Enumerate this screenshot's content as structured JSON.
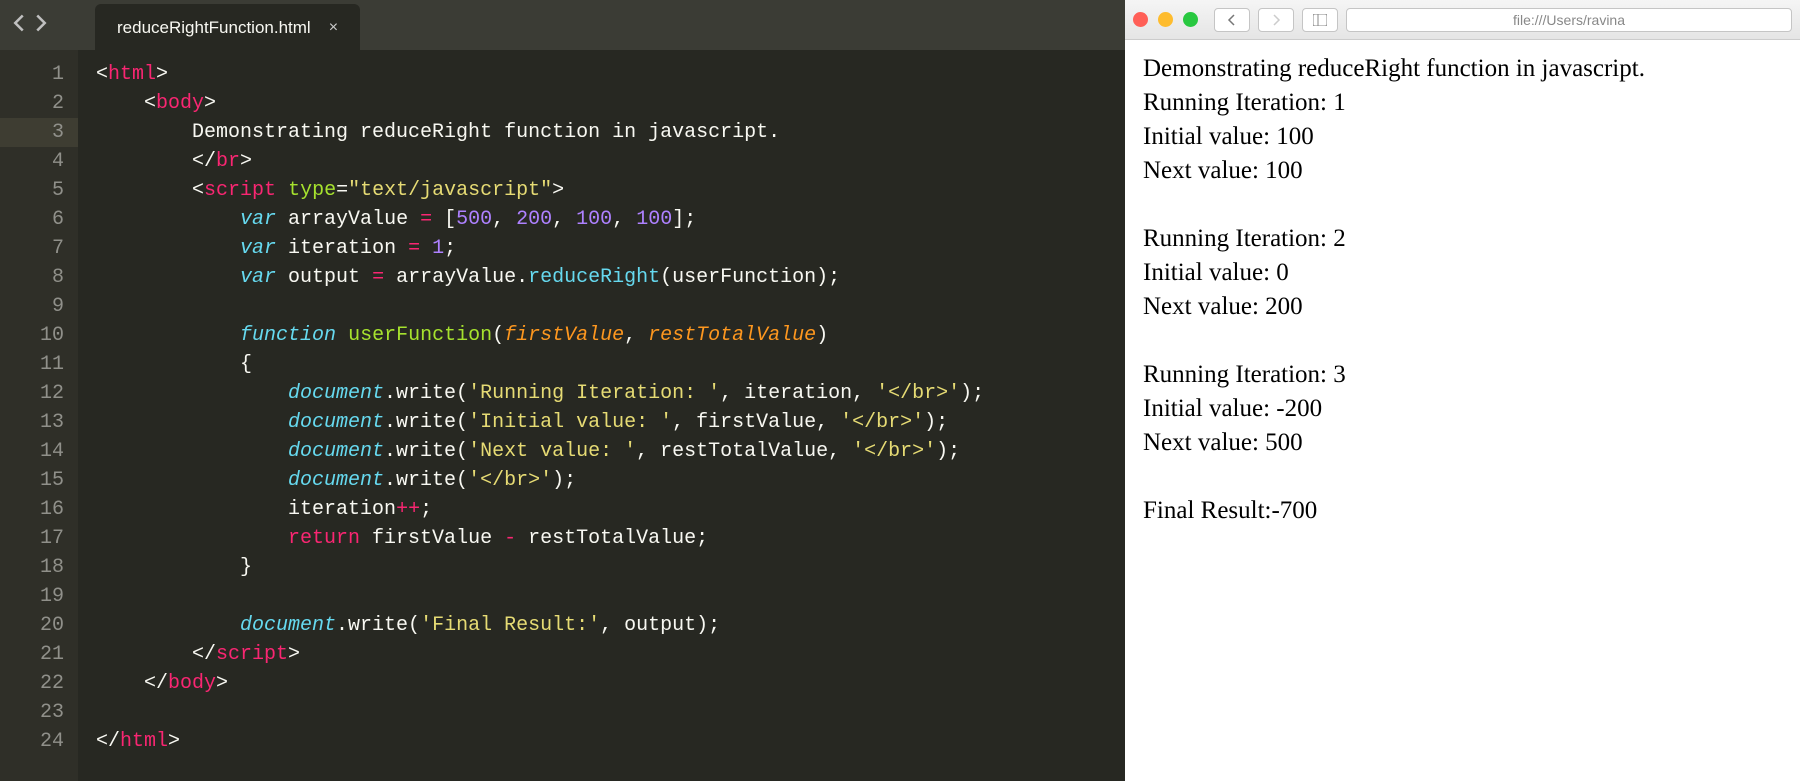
{
  "editor": {
    "tab_name": "reduceRightFunction.html",
    "line_count": 24,
    "highlighted_line": 3,
    "code_tokens": [
      [
        [
          "<",
          "c-white"
        ],
        [
          "html",
          "c-pink"
        ],
        [
          ">",
          "c-white"
        ]
      ],
      [
        [
          "    <",
          "c-white"
        ],
        [
          "body",
          "c-pink"
        ],
        [
          ">",
          "c-white"
        ]
      ],
      [
        [
          "        Demonstrating reduceRight function in javascript.",
          "c-white"
        ]
      ],
      [
        [
          "        </",
          "c-white"
        ],
        [
          "br",
          "c-pink"
        ],
        [
          ">",
          "c-white"
        ]
      ],
      [
        [
          "        <",
          "c-white"
        ],
        [
          "script",
          "c-pink"
        ],
        [
          " ",
          "c-white"
        ],
        [
          "type",
          "c-green"
        ],
        [
          "=",
          "c-white"
        ],
        [
          "\"text/javascript\"",
          "c-yellow"
        ],
        [
          ">",
          "c-white"
        ]
      ],
      [
        [
          "            ",
          "c-white"
        ],
        [
          "var",
          "c-cyan-i"
        ],
        [
          " arrayValue ",
          "c-white"
        ],
        [
          "=",
          "c-pink"
        ],
        [
          " [",
          "c-white"
        ],
        [
          "500",
          "c-purple"
        ],
        [
          ", ",
          "c-white"
        ],
        [
          "200",
          "c-purple"
        ],
        [
          ", ",
          "c-white"
        ],
        [
          "100",
          "c-purple"
        ],
        [
          ", ",
          "c-white"
        ],
        [
          "100",
          "c-purple"
        ],
        [
          "];",
          "c-white"
        ]
      ],
      [
        [
          "            ",
          "c-white"
        ],
        [
          "var",
          "c-cyan-i"
        ],
        [
          " iteration ",
          "c-white"
        ],
        [
          "=",
          "c-pink"
        ],
        [
          " ",
          "c-white"
        ],
        [
          "1",
          "c-purple"
        ],
        [
          ";",
          "c-white"
        ]
      ],
      [
        [
          "            ",
          "c-white"
        ],
        [
          "var",
          "c-cyan-i"
        ],
        [
          " output ",
          "c-white"
        ],
        [
          "=",
          "c-pink"
        ],
        [
          " arrayValue.",
          "c-white"
        ],
        [
          "reduceRight",
          "c-cyan"
        ],
        [
          "(userFunction);",
          "c-white"
        ]
      ],
      [
        [
          "",
          "c-white"
        ]
      ],
      [
        [
          "            ",
          "c-white"
        ],
        [
          "function",
          "c-cyan-i"
        ],
        [
          " ",
          "c-white"
        ],
        [
          "userFunction",
          "c-green"
        ],
        [
          "(",
          "c-white"
        ],
        [
          "firstValue",
          "c-orange"
        ],
        [
          ", ",
          "c-white"
        ],
        [
          "restTotalValue",
          "c-orange"
        ],
        [
          ")",
          "c-white"
        ]
      ],
      [
        [
          "            {",
          "c-white"
        ]
      ],
      [
        [
          "                ",
          "c-white"
        ],
        [
          "document",
          "c-cyan italic"
        ],
        [
          ".write(",
          "c-white"
        ],
        [
          "'Running Iteration: '",
          "c-yellow"
        ],
        [
          ", iteration, ",
          "c-white"
        ],
        [
          "'</br>'",
          "c-yellow"
        ],
        [
          ");",
          "c-white"
        ]
      ],
      [
        [
          "                ",
          "c-white"
        ],
        [
          "document",
          "c-cyan italic"
        ],
        [
          ".write(",
          "c-white"
        ],
        [
          "'Initial value: '",
          "c-yellow"
        ],
        [
          ", firstValue, ",
          "c-white"
        ],
        [
          "'</br>'",
          "c-yellow"
        ],
        [
          ");",
          "c-white"
        ]
      ],
      [
        [
          "                ",
          "c-white"
        ],
        [
          "document",
          "c-cyan italic"
        ],
        [
          ".write(",
          "c-white"
        ],
        [
          "'Next value: '",
          "c-yellow"
        ],
        [
          ", restTotalValue, ",
          "c-white"
        ],
        [
          "'</br>'",
          "c-yellow"
        ],
        [
          ");",
          "c-white"
        ]
      ],
      [
        [
          "                ",
          "c-white"
        ],
        [
          "document",
          "c-cyan italic"
        ],
        [
          ".write(",
          "c-white"
        ],
        [
          "'</br>'",
          "c-yellow"
        ],
        [
          ");",
          "c-white"
        ]
      ],
      [
        [
          "                iteration",
          "c-white"
        ],
        [
          "++",
          "c-pink"
        ],
        [
          ";",
          "c-white"
        ]
      ],
      [
        [
          "                ",
          "c-white"
        ],
        [
          "return",
          "c-pink"
        ],
        [
          " firstValue ",
          "c-white"
        ],
        [
          "-",
          "c-pink"
        ],
        [
          " restTotalValue;",
          "c-white"
        ]
      ],
      [
        [
          "            }",
          "c-white"
        ]
      ],
      [
        [
          "",
          "c-white"
        ]
      ],
      [
        [
          "            ",
          "c-white"
        ],
        [
          "document",
          "c-cyan italic"
        ],
        [
          ".write(",
          "c-white"
        ],
        [
          "'Final Result:'",
          "c-yellow"
        ],
        [
          ", output);",
          "c-white"
        ]
      ],
      [
        [
          "        </",
          "c-white"
        ],
        [
          "script",
          "c-pink"
        ],
        [
          ">",
          "c-white"
        ]
      ],
      [
        [
          "    </",
          "c-white"
        ],
        [
          "body",
          "c-pink"
        ],
        [
          ">",
          "c-white"
        ]
      ],
      [
        [
          "",
          "c-white"
        ]
      ],
      [
        [
          "</",
          "c-white"
        ],
        [
          "html",
          "c-pink"
        ],
        [
          ">",
          "c-white"
        ]
      ]
    ]
  },
  "browser": {
    "url_text": "file:///Users/ravina",
    "output_lines": [
      "Demonstrating reduceRight function in javascript.",
      "Running Iteration: 1",
      "Initial value: 100",
      "Next value: 100",
      "",
      "Running Iteration: 2",
      "Initial value: 0",
      "Next value: 200",
      "",
      "Running Iteration: 3",
      "Initial value: -200",
      "Next value: 500",
      "",
      "Final Result:-700"
    ]
  }
}
